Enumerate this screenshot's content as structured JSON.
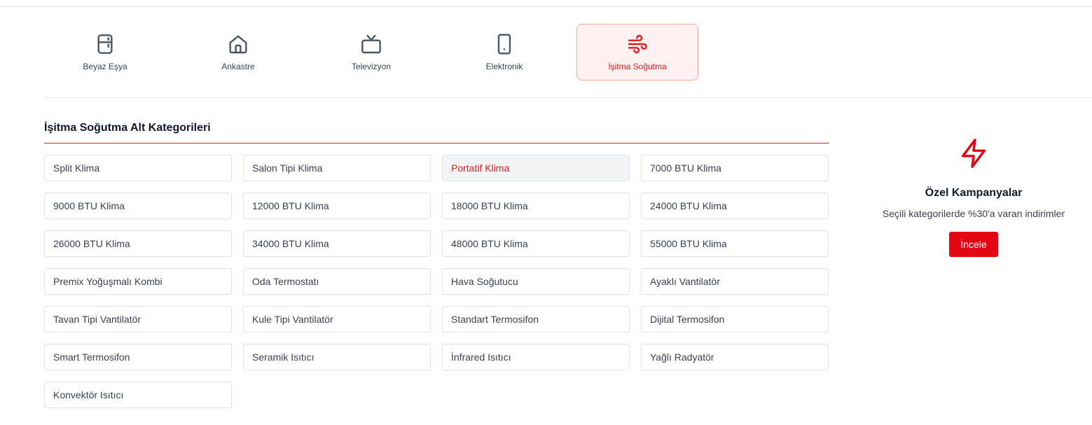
{
  "categories": [
    {
      "label": "Beyaz Eşya",
      "icon": "refrigerator-icon"
    },
    {
      "label": "Ankastre",
      "icon": "home-icon"
    },
    {
      "label": "Televizyon",
      "icon": "tv-icon"
    },
    {
      "label": "Elektronik",
      "icon": "smartphone-icon"
    },
    {
      "label": "İşitma Soğutma",
      "icon": "wind-icon",
      "active": true
    }
  ],
  "section": {
    "title": "İşitma Soğutma Alt Kategorileri"
  },
  "subcategories": [
    "Split Klima",
    "Salon Tipi Klima",
    "Portatif Klima",
    "7000 BTU Klima",
    "9000 BTU Klima",
    "12000 BTU Klima",
    "18000 BTU Klima",
    "24000 BTU Klima",
    "26000 BTU Klima",
    "34000 BTU Klima",
    "48000 BTU Klima",
    "55000 BTU Klima",
    "Premix Yoğuşmalı Kombi",
    "Oda Termostatı",
    "Hava Soğutucu",
    "Ayaklı Vantilatör",
    "Tavan Tipi Vantilatör",
    "Kule Tipi Vantilatör",
    "Standart Termosifon",
    "Dijital Termosifon",
    "Smart Termosifon",
    "Seramik Isıtıcı",
    "İnfrared Isıtıcı",
    "Yağlı Radyatör",
    "Konvektör Isıtıcı"
  ],
  "active_subcategory": "Portatif Klima",
  "promo": {
    "icon": "lightning-icon",
    "title": "Özel Kampanyalar",
    "subtitle": "Seçili kategorilerde %30'a varan indirimler",
    "button_label": "İncele"
  },
  "colors": {
    "accent": "#e30613",
    "active_bg": "#fff1f1",
    "active_border": "#fca5a5"
  }
}
